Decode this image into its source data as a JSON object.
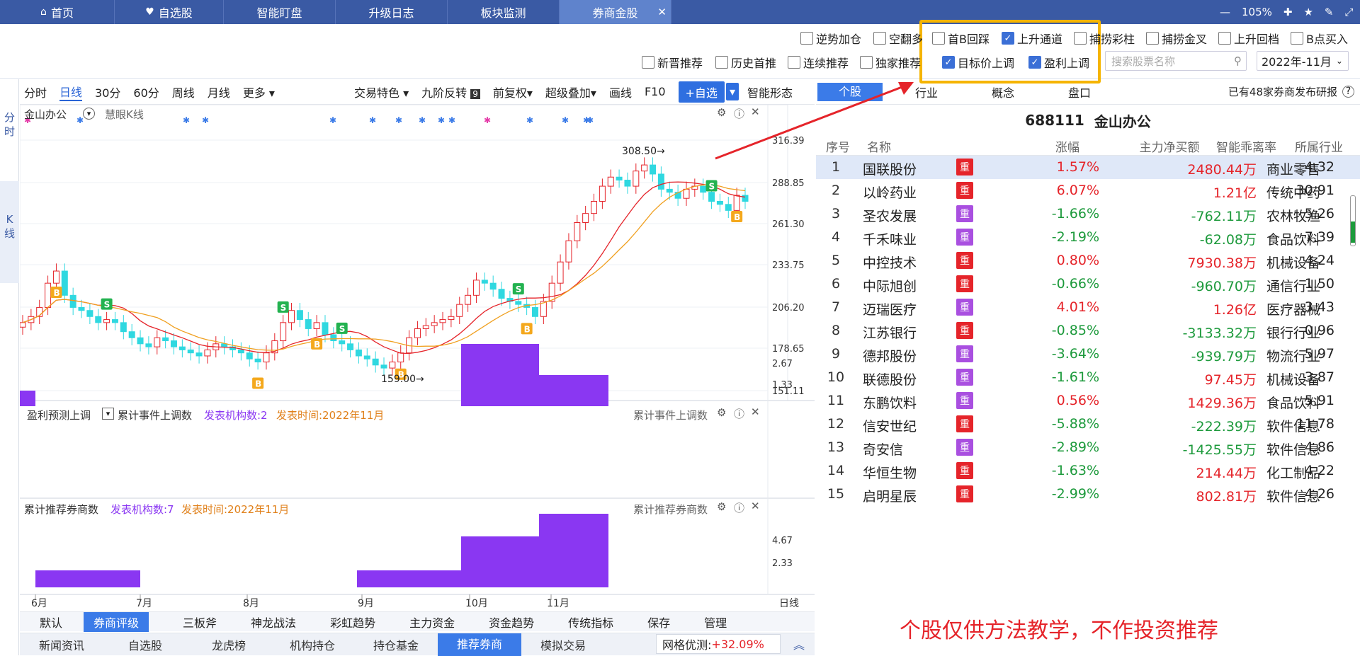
{
  "tabs": [
    {
      "label": "首页",
      "icon": "home-icon"
    },
    {
      "label": "自选股",
      "icon": "heart-icon"
    },
    {
      "label": "智能盯盘"
    },
    {
      "label": "升级日志"
    },
    {
      "label": "板块监测"
    },
    {
      "label": "券商金股",
      "active": true
    }
  ],
  "window": {
    "zoom": "105%"
  },
  "filters_row1": [
    {
      "label": "逆势加仓",
      "checked": false
    },
    {
      "label": "空翻多",
      "checked": false
    },
    {
      "label": "首B回踩",
      "checked": false
    },
    {
      "label": "上升通道",
      "checked": true
    },
    {
      "label": "捕捞彩柱",
      "checked": false
    },
    {
      "label": "捕捞金叉",
      "checked": false
    },
    {
      "label": "上升回档",
      "checked": false
    },
    {
      "label": "B点买入",
      "checked": false
    }
  ],
  "filters_row2": [
    {
      "label": "新晋推荐",
      "checked": false
    },
    {
      "label": "历史首推",
      "checked": false
    },
    {
      "label": "连续推荐",
      "checked": false
    },
    {
      "label": "独家推荐",
      "checked": false
    },
    {
      "label": "目标价上调",
      "checked": true
    },
    {
      "label": "盈利上调",
      "checked": true
    }
  ],
  "search": {
    "placeholder": "搜索股票名称"
  },
  "date_select": {
    "value": "2022年-11月"
  },
  "sidebar": {
    "items": [
      "分时",
      "K线"
    ]
  },
  "toolbar": {
    "periods": [
      "分时",
      "日线",
      "30分",
      "60分",
      "周线",
      "月线",
      "更多"
    ],
    "tools": [
      "交易特色",
      "九阶反转",
      "前复权",
      "超级叠加",
      "画线",
      "F10"
    ],
    "add_button": "+自选",
    "smart": "智能形态"
  },
  "stock_tabs": [
    "个股",
    "行业",
    "概念",
    "盘口"
  ],
  "report_note": "已有48家券商发布研报",
  "kline": {
    "stock": "金山办公",
    "indicator": "慧眼K线",
    "y_ticks": [
      "316.39",
      "288.85",
      "261.30",
      "233.75",
      "206.20",
      "178.65",
      "151.11"
    ],
    "high_label": "308.50",
    "low_label": "159.00",
    "x_months": [
      "6月",
      "7月",
      "8月",
      "9月",
      "10月",
      "11月"
    ],
    "x_period": "日线"
  },
  "panel2": {
    "title": "盈利预测上调",
    "sub": "累计事件上调数",
    "count": "发表机构数:2",
    "time": "发表时间:2022年11月",
    "right_label": "累计事件上调数",
    "y_ticks": [
      "2.67",
      "1.33"
    ]
  },
  "panel3": {
    "title": "累计推荐券商数",
    "count": "发表机构数:7",
    "time": "发表时间:2022年11月",
    "right_label": "累计推荐券商数",
    "y_ticks": [
      "4.67",
      "2.33"
    ]
  },
  "table": {
    "title_code": "688111",
    "title_name": "金山办公",
    "columns": [
      "序号",
      "名称",
      "涨幅",
      "主力净买额",
      "智能乖离率",
      "所属行业"
    ],
    "badge": "重",
    "rows": [
      {
        "no": "1",
        "name": "国联股份",
        "badge_color": "#e5242a",
        "chg": "1.57%",
        "net": "2480.44万",
        "dev": "4.32",
        "ind": "商业零售",
        "chg_up": true,
        "net_up": true
      },
      {
        "no": "2",
        "name": "以岭药业",
        "badge_color": "#e5242a",
        "chg": "6.07%",
        "net": "1.21亿",
        "dev": "30.91",
        "ind": "传统中药",
        "chg_up": true,
        "net_up": true
      },
      {
        "no": "3",
        "name": "圣农发展",
        "badge_color": "#a94fe0",
        "chg": "-1.66%",
        "net": "-762.11万",
        "dev": "5.26",
        "ind": "农林牧渔",
        "chg_up": false,
        "net_up": false
      },
      {
        "no": "4",
        "name": "千禾味业",
        "badge_color": "#a94fe0",
        "chg": "-2.19%",
        "net": "-62.08万",
        "dev": "7.39",
        "ind": "食品饮料",
        "chg_up": false,
        "net_up": false
      },
      {
        "no": "5",
        "name": "中控技术",
        "badge_color": "#e5242a",
        "chg": "0.80%",
        "net": "7930.38万",
        "dev": "4.24",
        "ind": "机械设备",
        "chg_up": true,
        "net_up": true
      },
      {
        "no": "6",
        "name": "中际旭创",
        "badge_color": "#e5242a",
        "chg": "-0.66%",
        "net": "-960.70万",
        "dev": "1.50",
        "ind": "通信行业",
        "chg_up": false,
        "net_up": false
      },
      {
        "no": "7",
        "name": "迈瑞医疗",
        "badge_color": "#a94fe0",
        "chg": "4.01%",
        "net": "1.26亿",
        "dev": "3.43",
        "ind": "医疗器械",
        "chg_up": true,
        "net_up": true
      },
      {
        "no": "8",
        "name": "江苏银行",
        "badge_color": "#e5242a",
        "chg": "-0.85%",
        "net": "-3133.32万",
        "dev": "0.96",
        "ind": "银行行业",
        "chg_up": false,
        "net_up": false
      },
      {
        "no": "9",
        "name": "德邦股份",
        "badge_color": "#a94fe0",
        "chg": "-3.64%",
        "net": "-939.79万",
        "dev": "5.97",
        "ind": "物流行业",
        "chg_up": false,
        "net_up": false
      },
      {
        "no": "10",
        "name": "联德股份",
        "badge_color": "#a94fe0",
        "chg": "-1.61%",
        "net": "97.45万",
        "dev": "3.87",
        "ind": "机械设备",
        "chg_up": false,
        "net_up": true
      },
      {
        "no": "11",
        "name": "东鹏饮料",
        "badge_color": "#a94fe0",
        "chg": "0.56%",
        "net": "1429.36万",
        "dev": "5.91",
        "ind": "食品饮料",
        "chg_up": true,
        "net_up": true
      },
      {
        "no": "12",
        "name": "信安世纪",
        "badge_color": "#e5242a",
        "chg": "-5.88%",
        "net": "-222.39万",
        "dev": "11.78",
        "ind": "软件信息",
        "chg_up": false,
        "net_up": false
      },
      {
        "no": "13",
        "name": "奇安信",
        "badge_color": "#a94fe0",
        "chg": "-2.89%",
        "net": "-1425.55万",
        "dev": "4.86",
        "ind": "软件信息",
        "chg_up": false,
        "net_up": false
      },
      {
        "no": "14",
        "name": "华恒生物",
        "badge_color": "#e5242a",
        "chg": "-1.63%",
        "net": "214.44万",
        "dev": "4.22",
        "ind": "化工制品",
        "chg_up": false,
        "net_up": true
      },
      {
        "no": "15",
        "name": "启明星辰",
        "badge_color": "#e5242a",
        "chg": "-2.99%",
        "net": "802.81万",
        "dev": "4.26",
        "ind": "软件信息",
        "chg_up": false,
        "net_up": true
      }
    ]
  },
  "bottom_tabs1": [
    "默认",
    "券商评级",
    "三板斧",
    "神龙战法",
    "彩虹趋势",
    "主力资金",
    "资金趋势",
    "传统指标",
    "保存",
    "管理"
  ],
  "bottom_tabs2": [
    "新闻资讯",
    "自选股",
    "龙虎榜",
    "机构持仓",
    "持仓基金",
    "推荐券商",
    "模拟交易"
  ],
  "grid_opt": {
    "label": "网格优测:",
    "value": "+32.09%"
  },
  "disclaimer": "个股仅供方法教学，不作投资推荐",
  "colors": {
    "accent": "#3b7be8",
    "up": "#e5242a",
    "down": "#1d9a3c",
    "candle_down": "#3fe0e8",
    "bar": "#8a37f2",
    "highlight": "#f5b400"
  }
}
